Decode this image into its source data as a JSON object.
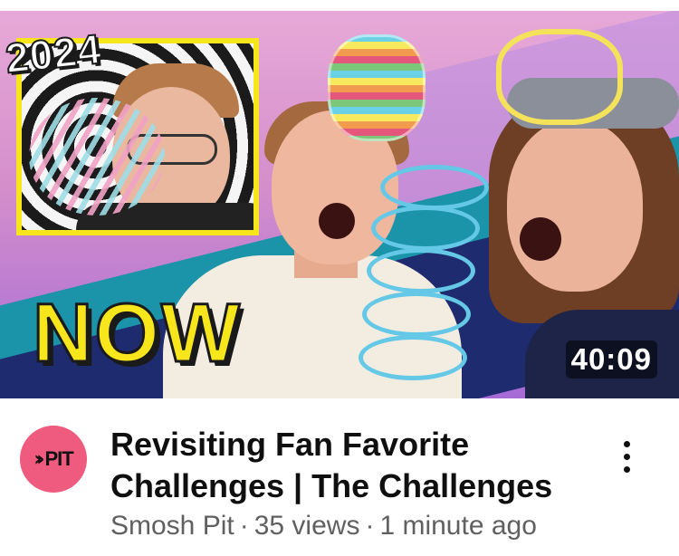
{
  "thumbnail": {
    "year_badge": "2024",
    "overlay_text": "NOW",
    "duration": "40:09",
    "colors": {
      "accent_yellow": "#f7e61b",
      "background_pink": "#d48fcb",
      "stripe_teal": "#1b93a8",
      "stripe_navy": "#1f2b6f"
    }
  },
  "video": {
    "title": "Revisiting Fan Favorite Challenges | The Challenges",
    "channel_avatar_text": "PIT",
    "channel_avatar_icon": "double-chevron-right-icon",
    "channel_name": "Smosh Pit",
    "views": "35 views",
    "age": "1 minute ago",
    "separator": "·",
    "more_icon": "vertical-ellipsis-icon",
    "avatar_color": "#ef5a7f"
  }
}
